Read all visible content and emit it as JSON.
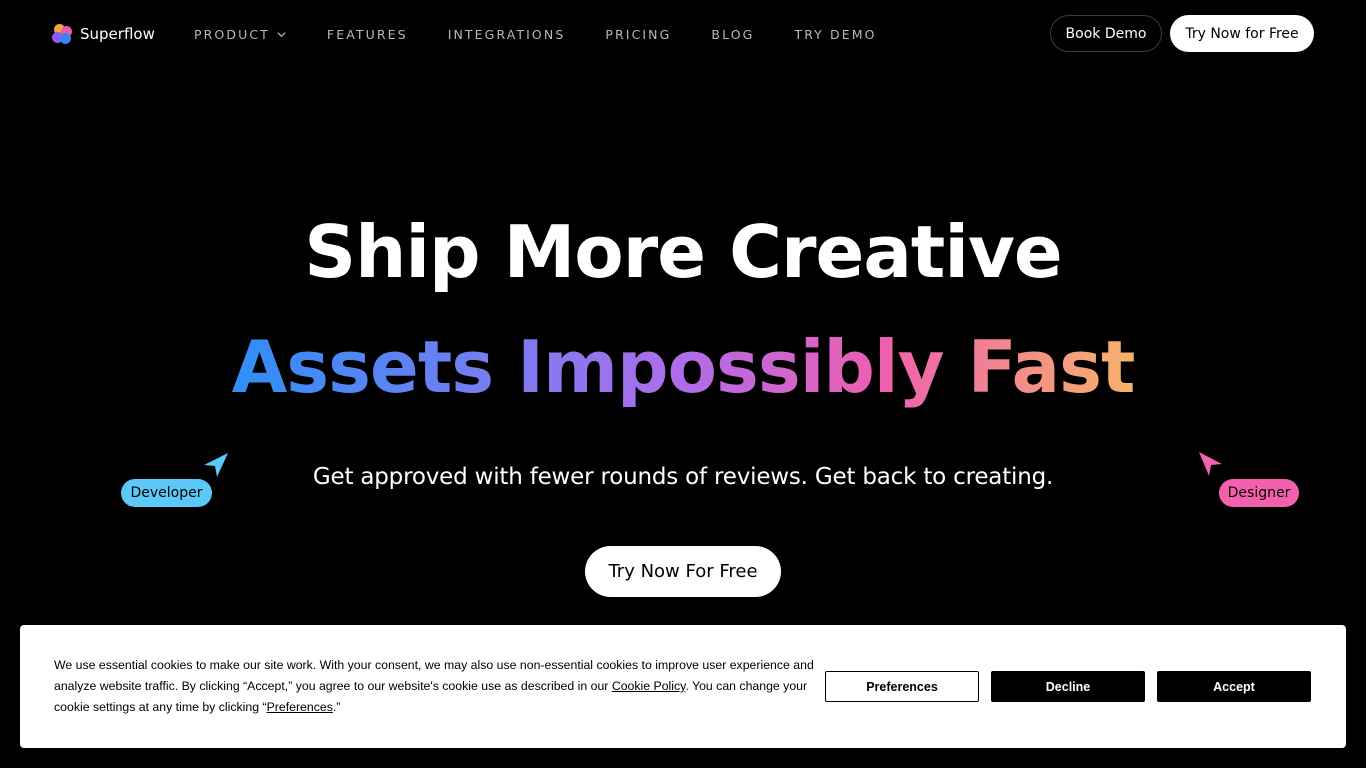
{
  "brand": {
    "name": "Superflow"
  },
  "nav": {
    "items": [
      {
        "label": "PRODUCT",
        "has_dropdown": true
      },
      {
        "label": "FEATURES"
      },
      {
        "label": "INTEGRATIONS"
      },
      {
        "label": "PRICING"
      },
      {
        "label": "BLOG"
      },
      {
        "label": "TRY DEMO"
      }
    ],
    "book_demo_label": "Book Demo",
    "try_now_label": "Try Now for Free"
  },
  "hero": {
    "line1": "Ship More Creative",
    "line2": "Assets Impossibly Fast",
    "subtitle": "Get approved with fewer rounds of reviews. Get back to creating.",
    "cta_label": "Try Now For Free"
  },
  "cursor_tags": {
    "developer": {
      "label": "Developer",
      "color": "#5cc8f7"
    },
    "designer": {
      "label": "Designer",
      "color": "#f360ad"
    }
  },
  "cookie_banner": {
    "text_part1": "We use essential cookies to make our site work. With your consent, we may also use non-essential cookies to improve user experience and analyze website traffic. By clicking “Accept,” you agree to our website's cookie use as described in our ",
    "cookie_policy_link": "Cookie Policy",
    "text_part2": ". You can change your cookie settings at any time by clicking “",
    "preferences_link": "Preferences",
    "text_part3": ".”",
    "preferences_label": "Preferences",
    "decline_label": "Decline",
    "accept_label": "Accept"
  },
  "colors": {
    "background": "#000000",
    "gradient": [
      "#2f8ff8",
      "#7a7cf0",
      "#b06cea",
      "#ee5fb0",
      "#f7b36a"
    ]
  }
}
